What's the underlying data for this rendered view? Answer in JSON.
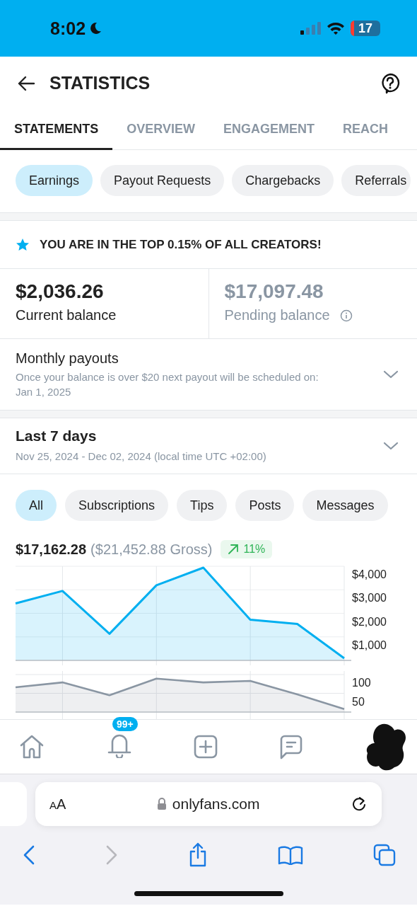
{
  "status_bar": {
    "time": "8:02",
    "battery": "17"
  },
  "header": {
    "title": "STATISTICS"
  },
  "tabs": [
    {
      "label": "STATEMENTS",
      "selected": true
    },
    {
      "label": "OVERVIEW",
      "selected": false
    },
    {
      "label": "ENGAGEMENT",
      "selected": false
    },
    {
      "label": "REACH",
      "selected": false
    }
  ],
  "categories": [
    {
      "label": "Earnings",
      "selected": true
    },
    {
      "label": "Payout Requests",
      "selected": false
    },
    {
      "label": "Chargebacks",
      "selected": false
    },
    {
      "label": "Referrals",
      "selected": false
    }
  ],
  "banner": {
    "text": "YOU ARE IN THE TOP 0.15% OF ALL CREATORS!"
  },
  "balances": [
    {
      "amount": "$2,036.26",
      "label": "Current balance",
      "pending": false
    },
    {
      "amount": "$17,097.48",
      "label": "Pending balance",
      "pending": true
    }
  ],
  "payouts": {
    "title": "Monthly payouts",
    "note": "Once your balance is over $20 next payout will be scheduled on: Jan 1, 2025",
    "expanded": false
  },
  "period": {
    "title": "Last 7 days",
    "range": "Nov 25, 2024 - Dec 02, 2024 (local time UTC +02:00)",
    "expanded": false
  },
  "filters": [
    {
      "label": "All",
      "selected": true
    },
    {
      "label": "Subscriptions",
      "selected": false
    },
    {
      "label": "Tips",
      "selected": false
    },
    {
      "label": "Posts",
      "selected": false
    },
    {
      "label": "Messages",
      "selected": false
    }
  ],
  "summary": {
    "net": "$17,162.28",
    "gross": "($21,452.88 Gross)",
    "change": "11%",
    "rising": true
  },
  "earnings_chart": {
    "chart_data": {
      "type": "area",
      "grid": true,
      "ylim": [
        0,
        4000
      ],
      "yticks": [
        {
          "value": 1000,
          "label": "$1,000"
        },
        {
          "value": 2000,
          "label": "$2,000"
        },
        {
          "value": 3000,
          "label": "$3,000"
        },
        {
          "value": 4000,
          "label": "$4,000"
        }
      ],
      "series": [
        {
          "color": "#00aff0",
          "values": [
            2420,
            2950,
            1130,
            3190,
            3940,
            1730,
            1550,
            90
          ]
        }
      ]
    }
  },
  "count_chart": {
    "chart_data": {
      "type": "area",
      "grid": true,
      "ylim": [
        0,
        100
      ],
      "yticks": [
        50,
        100
      ],
      "series": [
        {
          "color": "#8a96a3",
          "values": [
            66,
            79,
            45,
            89,
            79,
            83,
            47,
            8
          ]
        }
      ]
    }
  },
  "bottom_nav": [
    {
      "kind": "home"
    },
    {
      "kind": "notifications",
      "badge": "99+"
    },
    {
      "kind": "add"
    },
    {
      "kind": "messages"
    },
    {
      "kind": "avatar"
    }
  ],
  "browser": {
    "text_size": "AA",
    "url": "onlyfans.com",
    "back_disabled": false,
    "forward_disabled": true
  }
}
